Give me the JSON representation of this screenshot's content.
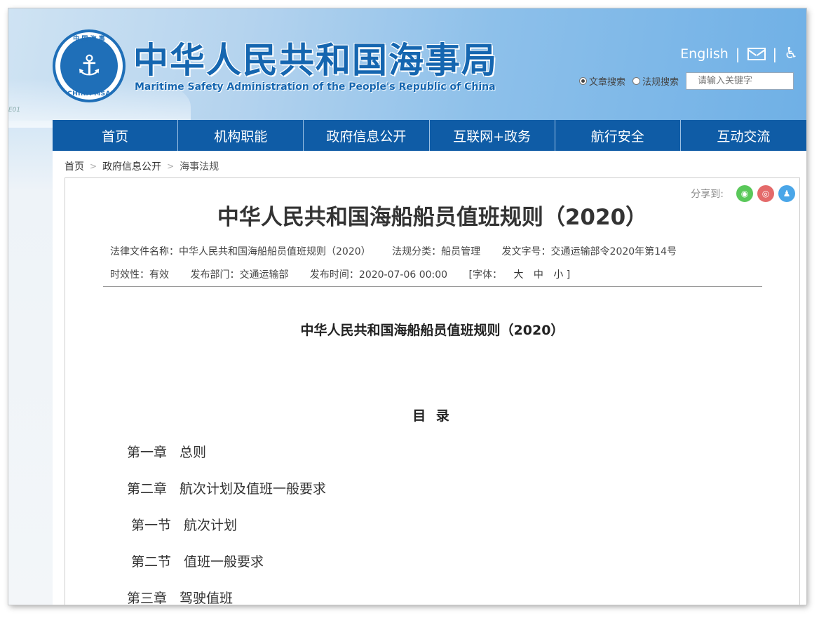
{
  "header": {
    "title_cn": "中华人民共和国海事局",
    "title_en": "Maritime Safety Administration of the People's Republic of China",
    "logo_top": "中 国 海 事",
    "logo_bottom": "CHINA MSA",
    "logo_glyph": "⚓",
    "ship_mark": "E01",
    "english_link": "English",
    "separator": "|",
    "mail_icon": "mail-icon",
    "accessibility_icon": "♿",
    "search_option_article": "文章搜索",
    "search_option_law": "法规搜索",
    "search_placeholder": "请输入关键字"
  },
  "nav": {
    "items": [
      "首页",
      "机构职能",
      "政府信息公开",
      "互联网+政务",
      "航行安全",
      "互动交流"
    ]
  },
  "breadcrumb": {
    "home": "首页",
    "sep": ">",
    "level1": "政府信息公开",
    "current": "海事法规"
  },
  "article": {
    "share_label": "分享到:",
    "share_wechat": "◉",
    "share_weibo": "◎",
    "share_qq": "♟",
    "title": "中华人民共和国海船船员值班规则（2020）",
    "meta": {
      "name": "法律文件名称：中华人民共和国海船船员值班规则（2020）",
      "category": "法规分类：船员管理",
      "doc_no": "发文字号：交通运输部令2020年第14号",
      "validity": "时效性：有效",
      "department": "发布部门：交通运输部",
      "publish_time": "发布时间：2020-07-06 00:00",
      "font_label": "[字体：",
      "font_large": "大",
      "font_medium": "中",
      "font_small": "小 ]"
    },
    "doc_title": "中华人民共和国海船船员值班规则（2020）",
    "toc_title": "目 录",
    "toc": [
      {
        "num": "第一章",
        "text": "总则",
        "sub": false
      },
      {
        "num": "第二章",
        "text": "航次计划及值班一般要求",
        "sub": false
      },
      {
        "num": "第一节",
        "text": "航次计划",
        "sub": true
      },
      {
        "num": "第二节",
        "text": "值班一般要求",
        "sub": true
      },
      {
        "num": "第三章",
        "text": "驾驶值班",
        "sub": false
      }
    ]
  },
  "colors": {
    "nav_bg": "#0f5ca6",
    "title_blue": "#1566b0"
  }
}
